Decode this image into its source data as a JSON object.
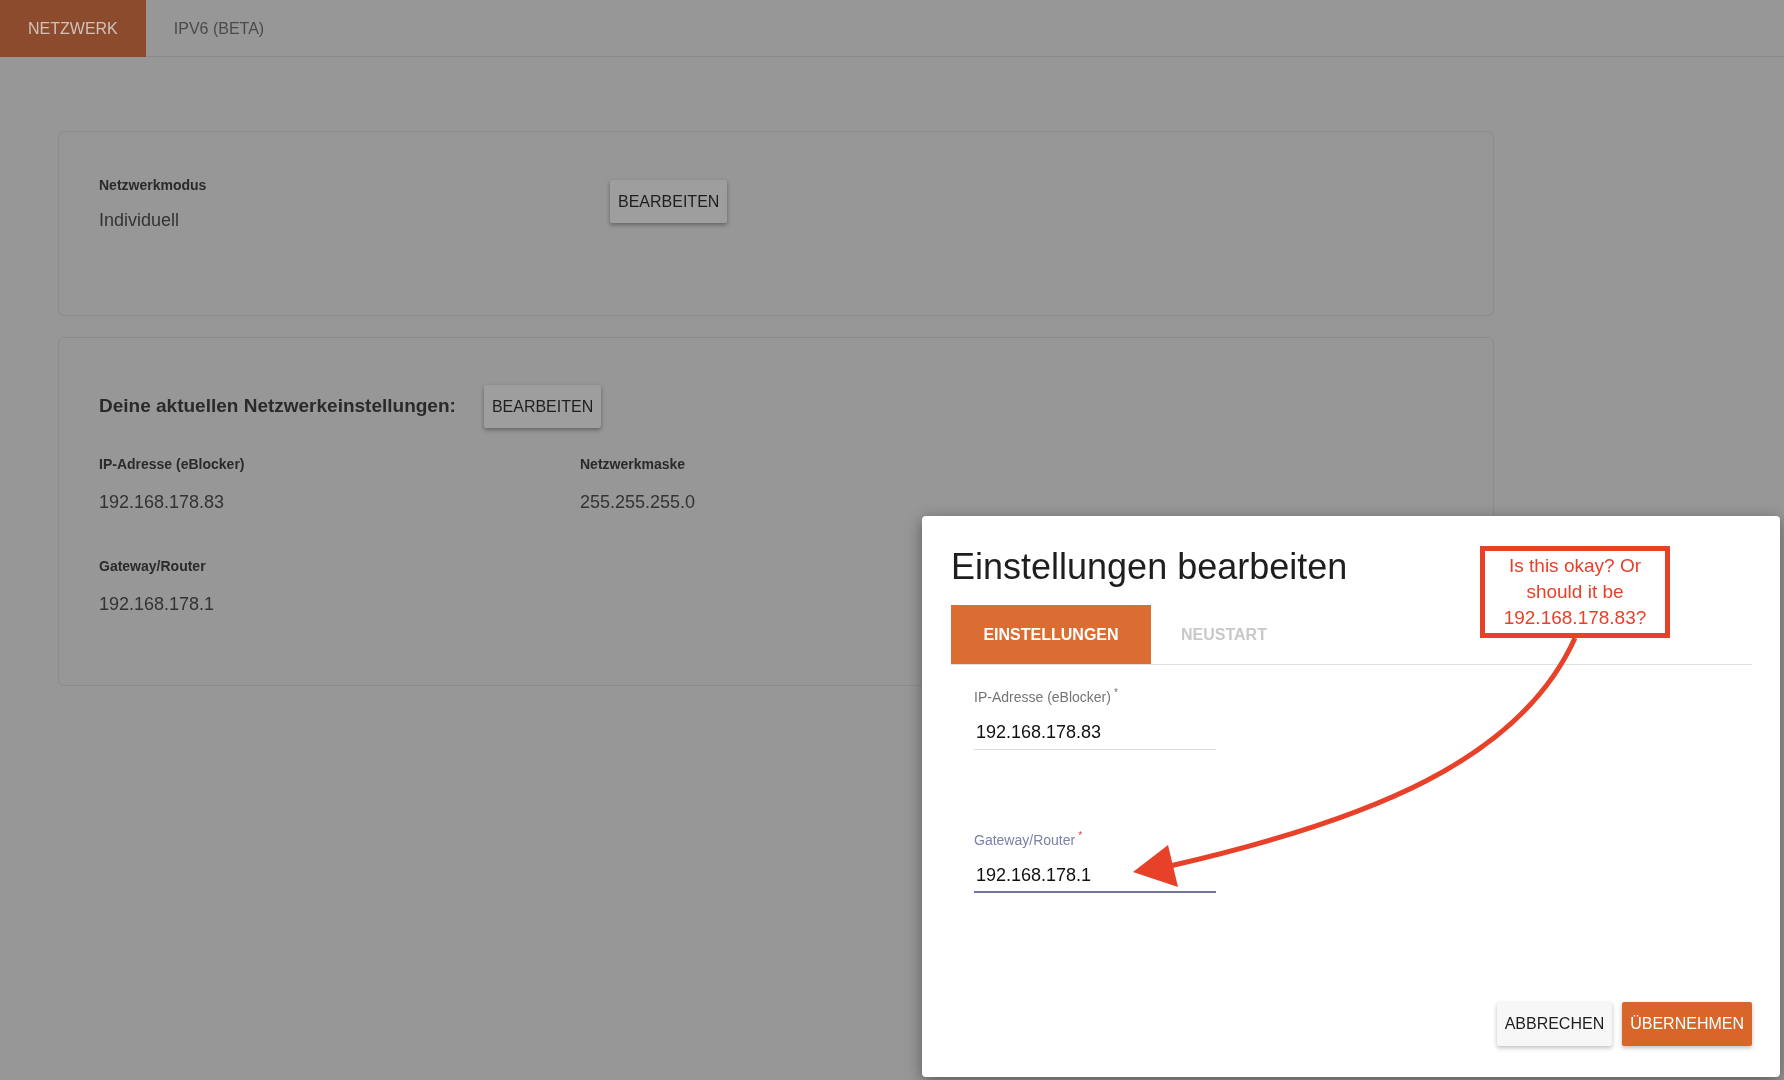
{
  "tabs": [
    {
      "label": "NETZWERK",
      "selected": true
    },
    {
      "label": "IPV6 (BETA)",
      "selected": false
    }
  ],
  "mode_card": {
    "label": "Netzwerkmodus",
    "value": "Individuell",
    "button": "BEARBEITEN"
  },
  "settings_card": {
    "heading": "Deine aktuellen Netzwerkeinstellungen:",
    "button": "BEARBEITEN",
    "fields": [
      {
        "label": "IP-Adresse (eBlocker)",
        "value": "192.168.178.83"
      },
      {
        "label": "Netzwerkmaske",
        "value": "255.255.255.0"
      },
      {
        "label": "Gateway/Router",
        "value": "192.168.178.1"
      }
    ]
  },
  "dialog": {
    "title": "Einstellungen bearbeiten",
    "tabs": [
      {
        "label": "EINSTELLUNGEN",
        "selected": true
      },
      {
        "label": "NEUSTART",
        "selected": false
      }
    ],
    "fields": [
      {
        "label": "IP-Adresse (eBlocker)",
        "required_mark": "*",
        "value": "192.168.178.83",
        "focused": false
      },
      {
        "label": "Gateway/Router",
        "required_mark": "*",
        "value": "192.168.178.1",
        "focused": true
      }
    ],
    "buttons": [
      {
        "label": "ABBRECHEN",
        "kind": "secondary"
      },
      {
        "label": "ÜBERNEHMEN",
        "kind": "primary"
      }
    ]
  },
  "annotation": {
    "text": "Is this okay? Or should it be 192.168.178.83?"
  }
}
